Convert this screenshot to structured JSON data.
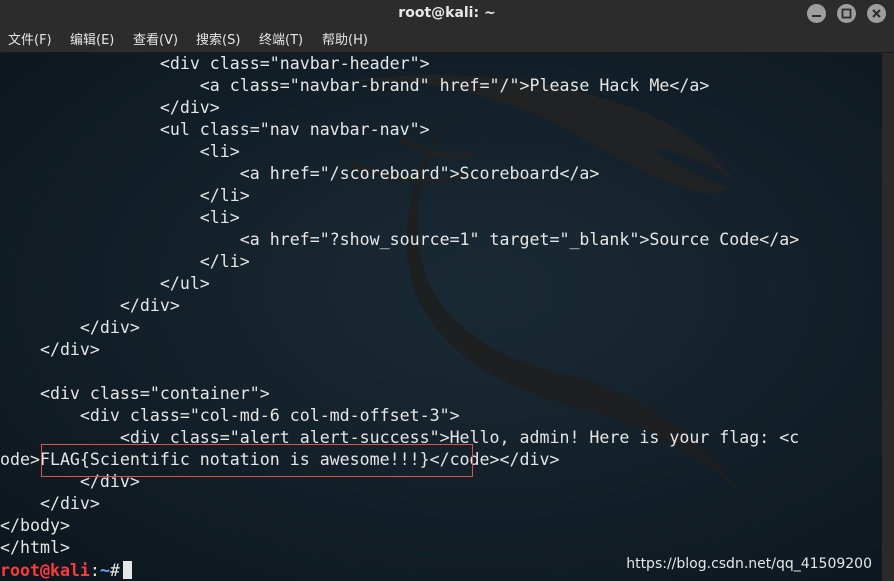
{
  "window": {
    "title": "root@kali: ~",
    "controls": [
      "minimize-icon",
      "maximize-icon",
      "close-icon"
    ]
  },
  "menu": {
    "items": [
      "文件(F)",
      "编辑(E)",
      "查看(V)",
      "搜索(S)",
      "终端(T)",
      "帮助(H)"
    ]
  },
  "terminal": {
    "lines": [
      "                <div class=\"navbar-header\">",
      "                    <a class=\"navbar-brand\" href=\"/\">Please Hack Me</a>",
      "                </div>",
      "                <ul class=\"nav navbar-nav\">",
      "                    <li>",
      "                        <a href=\"/scoreboard\">Scoreboard</a>",
      "                    </li>",
      "                    <li>",
      "                        <a href=\"?show_source=1\" target=\"_blank\">Source Code</a>",
      "                    </li>",
      "                </ul>",
      "            </div>",
      "        </div>",
      "    </div>",
      "",
      "    <div class=\"container\">",
      "        <div class=\"col-md-6 col-md-offset-3\">",
      "            <div class=\"alert alert-success\">Hello, admin! Here is your flag: <c",
      "ode>FLAG{Scientific notation is awesome!!!}</code></div>",
      "        </div>",
      "    </div>",
      "</body>",
      "</html>"
    ],
    "prompt": {
      "user_host": "root@kali",
      "sep": ":",
      "path": "~",
      "symbol": "#"
    },
    "highlight_text": "FLAG{Scientific notation is awesome!!!}"
  },
  "watermark": "https://blog.csdn.net/qq_41509200",
  "colors": {
    "terminal_bg": "#131f29",
    "text": "#e6e6e6",
    "prompt_user": "#ff3b3b",
    "prompt_path": "#6aa4ff",
    "highlight_box": "#d9534f"
  }
}
